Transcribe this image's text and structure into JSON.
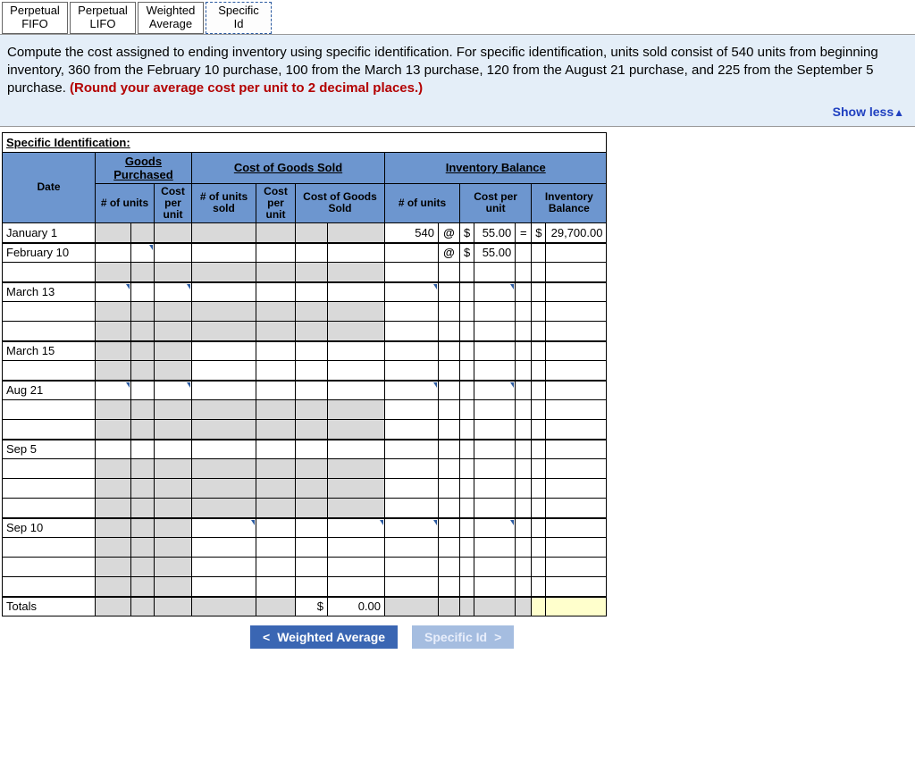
{
  "tabs": [
    {
      "line1": "Perpetual",
      "line2": "FIFO"
    },
    {
      "line1": "Perpetual",
      "line2": "LIFO"
    },
    {
      "line1": "Weighted",
      "line2": "Average"
    },
    {
      "line1": "Specific",
      "line2": "Id",
      "active": true
    }
  ],
  "question": {
    "text": "Compute the cost assigned to ending inventory using specific identification. For specific identification, units sold consist of 540 units from beginning inventory, 360 from the February 10 purchase, 100 from the March 13 purchase, 120 from the August 21 purchase, and 225 from the September 5 purchase. ",
    "emph": "(Round your average cost per unit to 2 decimal places.)",
    "toggle": "Show less",
    "toggle_icon": "▲"
  },
  "sheet": {
    "title": "Specific Identification:",
    "groups": {
      "gp": "Goods Purchased",
      "cogs": "Cost of Goods Sold",
      "ib": "Inventory Balance"
    },
    "cols": {
      "date": "Date",
      "gp_units": "# of units",
      "gp_cost": "Cost per unit",
      "cs_units": "# of units sold",
      "cs_cost": "Cost per unit",
      "cs_total": "Cost of Goods Sold",
      "ib_units": "# of units",
      "ib_cost": "Cost per unit",
      "ib_bal": "Inventory Balance"
    },
    "rows": {
      "r0": {
        "date": "January 1",
        "ib_units": "540",
        "at": "@",
        "ib_cost_cur": "$",
        "ib_cost": "55.00",
        "eq": "=",
        "ib_bal_cur": "$",
        "ib_bal": "29,700.00"
      },
      "r1": {
        "date": "February 10",
        "at": "@",
        "ib_cost_cur": "$",
        "ib_cost": "55.00"
      },
      "r2": {
        "date": "March 13"
      },
      "r3": {
        "date": "March 15"
      },
      "r4": {
        "date": "Aug 21"
      },
      "r5": {
        "date": "Sep 5"
      },
      "r6": {
        "date": "Sep 10"
      },
      "totals": {
        "label": "Totals",
        "cs_total_cur": "$",
        "cs_total": "0.00"
      }
    }
  },
  "footer": {
    "prev": "Weighted Average",
    "next": "Specific Id"
  }
}
